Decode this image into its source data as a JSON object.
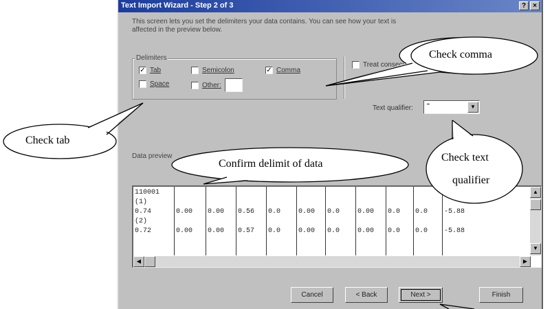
{
  "window": {
    "title": "Text Import Wizard - Step 2 of 3",
    "help_btn": "?",
    "close_btn": "×"
  },
  "intro": "This screen lets you set the delimiters your data contains.  You can see how your text is affected in the preview below.",
  "delimiters": {
    "legend": "Delimiters",
    "tab": {
      "label": "Tab",
      "checked": true
    },
    "semicolon": {
      "label": "Semicolon",
      "checked": false
    },
    "comma": {
      "label": "Comma",
      "checked": true
    },
    "space": {
      "label": "Space",
      "checked": false
    },
    "other": {
      "label": "Other:",
      "checked": false,
      "value": ""
    }
  },
  "treat_consecutive": {
    "label": "Treat consecutive delimiters as one",
    "checked": false
  },
  "text_qualifier": {
    "label": "Text qualifier:",
    "value": "\""
  },
  "preview": {
    "label": "Data preview",
    "columns": [
      [
        "110001",
        "(1)",
        "0.74",
        "(2)",
        "0.72"
      ],
      [
        "",
        "",
        "0.00",
        "",
        "0.00"
      ],
      [
        "",
        "",
        "0.00",
        "",
        "0.00"
      ],
      [
        "",
        "",
        "0.56",
        "",
        "0.57"
      ],
      [
        "",
        "",
        "0.0",
        "",
        "0.0"
      ],
      [
        "",
        "",
        "0.00",
        "",
        "0.00"
      ],
      [
        "",
        "",
        "0.0",
        "",
        "0.0"
      ],
      [
        "",
        "",
        "0.00",
        "",
        "0.00"
      ],
      [
        "",
        "",
        "0.0",
        "",
        "0.0"
      ],
      [
        "",
        "",
        "0.0",
        "",
        "0.0"
      ],
      [
        "",
        "",
        "-5.88",
        "",
        "-5.88"
      ]
    ]
  },
  "buttons": {
    "cancel": "Cancel",
    "back": "< Back",
    "next": "Next >",
    "finish": "Finish"
  },
  "callouts": {
    "check_comma": "Check comma",
    "check_tab": "Check tab",
    "confirm_delimit": "Confirm delimit of data",
    "check_text": "Check text",
    "qualifier": "qualifier"
  }
}
